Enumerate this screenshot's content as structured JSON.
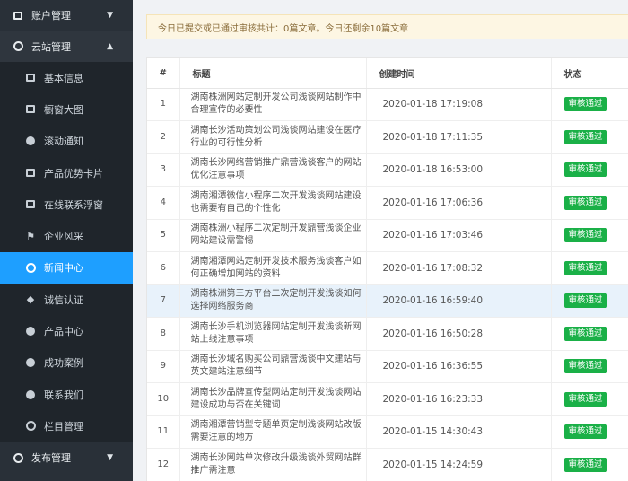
{
  "sidebar": {
    "groups": [
      {
        "label": "账户管理",
        "icon": "monitor-icon",
        "expanded": false
      },
      {
        "label": "云站管理",
        "icon": "cloud-icon",
        "expanded": true
      },
      {
        "label": "发布管理",
        "icon": "compass-icon",
        "expanded": false
      }
    ],
    "items": [
      {
        "label": "基本信息",
        "icon": "book-icon"
      },
      {
        "label": "橱窗大图",
        "icon": "display-icon"
      },
      {
        "label": "滚动通知",
        "icon": "megaphone-icon"
      },
      {
        "label": "产品优势卡片",
        "icon": "box-icon"
      },
      {
        "label": "在线联系浮窗",
        "icon": "window-icon"
      },
      {
        "label": "企业风采",
        "icon": "flag-icon"
      },
      {
        "label": "新闻中心",
        "icon": "globe-icon",
        "active": true
      },
      {
        "label": "诚信认证",
        "icon": "shield-icon"
      },
      {
        "label": "产品中心",
        "icon": "leaf-icon"
      },
      {
        "label": "成功案例",
        "icon": "trophy-icon"
      },
      {
        "label": "联系我们",
        "icon": "contact-icon"
      },
      {
        "label": "栏目管理",
        "icon": "column-icon"
      }
    ]
  },
  "notice": "今日已提交或已通过审核共计：0篇文章。今日还剩余10篇文章",
  "table": {
    "headers": [
      "#",
      "标题",
      "创建时间",
      "状态"
    ],
    "rows": [
      {
        "num": "1",
        "title": "湖南株洲网站定制开发公司浅谈网站制作中合理宣传的必要性",
        "time": "2020-01-18 17:19:08",
        "status": "审核通过"
      },
      {
        "num": "2",
        "title": "湖南长沙活动策划公司浅谈网站建设在医疗行业的可行性分析",
        "time": "2020-01-18 17:11:35",
        "status": "审核通过"
      },
      {
        "num": "3",
        "title": "湖南长沙网络营销推广鼎营浅谈客户的网站优化注意事项",
        "time": "2020-01-18 16:53:00",
        "status": "审核通过"
      },
      {
        "num": "4",
        "title": "湖南湘潭微信小程序二次开发浅谈网站建设也需要有自己的个性化",
        "time": "2020-01-16 17:06:36",
        "status": "审核通过"
      },
      {
        "num": "5",
        "title": "湖南株洲小程序二次定制开发鼎营浅谈企业网站建设需警惕",
        "time": "2020-01-16 17:03:46",
        "status": "审核通过"
      },
      {
        "num": "6",
        "title": "湖南湘潭网站定制开发技术服务浅谈客户如何正确增加网站的资料",
        "time": "2020-01-16 17:08:32",
        "status": "审核通过"
      },
      {
        "num": "7",
        "title": "湖南株洲第三方平台二次定制开发浅谈如何选择网络服务商",
        "time": "2020-01-16 16:59:40",
        "status": "审核通过"
      },
      {
        "num": "8",
        "title": "湖南长沙手机浏览器网站定制开发浅谈新网站上线注意事项",
        "time": "2020-01-16 16:50:28",
        "status": "审核通过"
      },
      {
        "num": "9",
        "title": "湖南长沙域名购买公司鼎营浅谈中文建站与英文建站注意细节",
        "time": "2020-01-16 16:36:55",
        "status": "审核通过"
      },
      {
        "num": "10",
        "title": "湖南长沙品牌宣传型网站定制开发浅谈网站建设成功与否在关键词",
        "time": "2020-01-16 16:23:33",
        "status": "审核通过"
      },
      {
        "num": "11",
        "title": "湖南湘潭营销型专题单页定制浅谈网站改版需要注意的地方",
        "time": "2020-01-15 14:30:43",
        "status": "审核通过"
      },
      {
        "num": "12",
        "title": "湖南长沙网站单次修改升级浅谈外贸网站群推广需注意",
        "time": "2020-01-15 14:24:59",
        "status": "审核通过"
      }
    ]
  },
  "colors": {
    "sidebar_bg": "#293038",
    "active": "#1e9fff",
    "badge": "#1ab047",
    "notice_bg": "#fdf6e3"
  }
}
